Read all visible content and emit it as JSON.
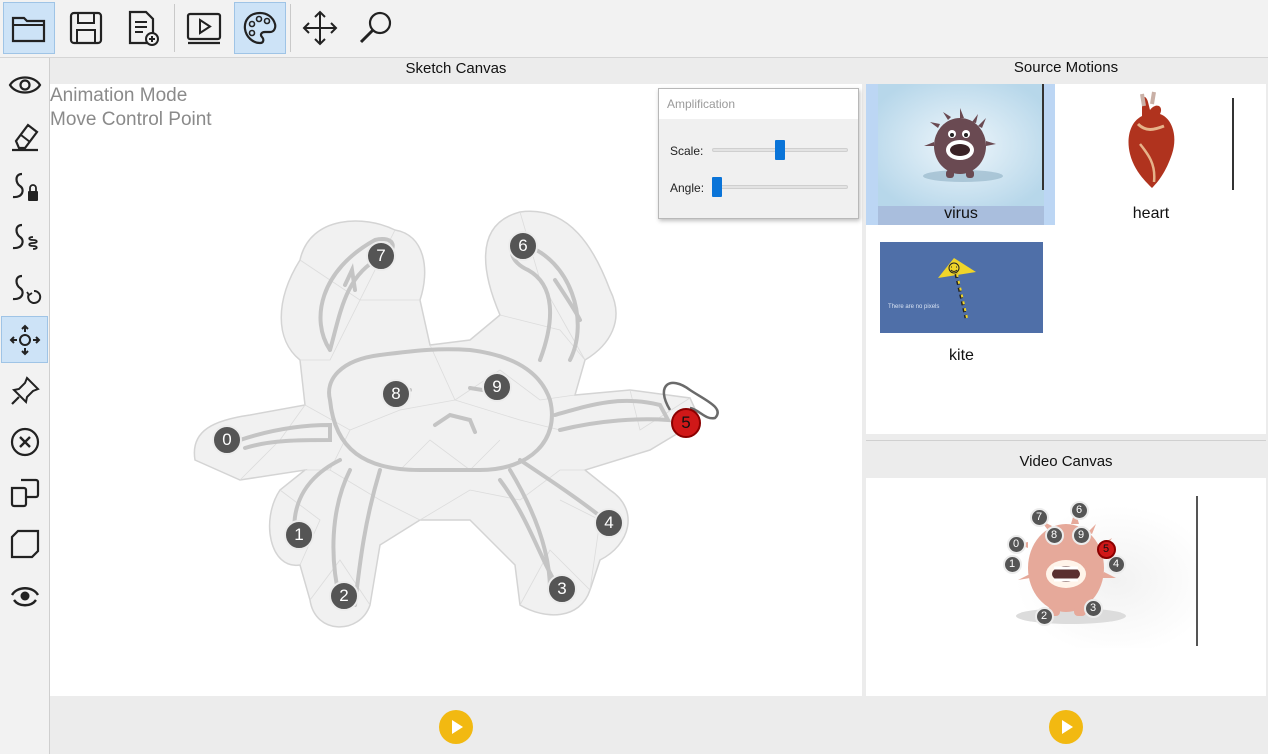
{
  "toolbar": {
    "buttons": [
      {
        "name": "open-folder-icon",
        "active": true
      },
      {
        "name": "save-icon",
        "active": false
      },
      {
        "name": "new-file-icon",
        "active": false
      },
      {
        "name": "video-player-icon",
        "active": false
      },
      {
        "name": "palette-icon",
        "active": true
      },
      {
        "name": "move-arrows-icon",
        "active": false
      },
      {
        "name": "search-icon",
        "active": false
      }
    ]
  },
  "left_tools": [
    {
      "name": "eye-icon",
      "active": false
    },
    {
      "name": "eraser-icon",
      "active": false
    },
    {
      "name": "stroke-lock-icon",
      "active": false
    },
    {
      "name": "stroke-spring-icon",
      "active": false
    },
    {
      "name": "stroke-rotate-icon",
      "active": false
    },
    {
      "name": "move-control-point-icon",
      "active": true
    },
    {
      "name": "pin-icon",
      "active": false
    },
    {
      "name": "close-circle-icon",
      "active": false
    },
    {
      "name": "copy-layers-icon",
      "active": false
    },
    {
      "name": "layer-icon",
      "active": false
    },
    {
      "name": "view-rotate-icon",
      "active": false
    }
  ],
  "sketch": {
    "title": "Sketch Canvas",
    "mode_line1": "Animation Mode",
    "mode_line2": "Move Control Point",
    "control_points": [
      "0",
      "1",
      "2",
      "3",
      "4",
      "5",
      "6",
      "7",
      "8",
      "9"
    ],
    "selected_point": "5"
  },
  "amplification": {
    "title": "Amplification",
    "scale_label": "Scale:",
    "scale_value": 0.5,
    "angle_label": "Angle:",
    "angle_value": 0.0
  },
  "source_motions": {
    "title": "Source Motions",
    "items": [
      {
        "label": "virus",
        "selected": true
      },
      {
        "label": "heart",
        "selected": false
      },
      {
        "label": "kite",
        "selected": false,
        "caption": "There are no pixels"
      }
    ]
  },
  "video_canvas": {
    "title": "Video Canvas",
    "control_points": [
      "0",
      "1",
      "2",
      "3",
      "4",
      "5",
      "6",
      "7",
      "8",
      "9"
    ]
  },
  "colors": {
    "accent": "#0a74d8",
    "selection": "#cde3f7",
    "play": "#f2b911",
    "selected_point": "#d01818"
  }
}
